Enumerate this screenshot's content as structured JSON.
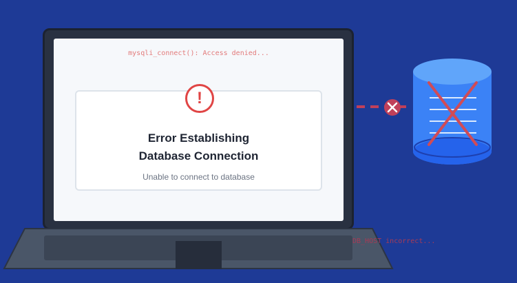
{
  "log": {
    "top": "mysqli_connect(): Access denied...",
    "bottom": "DB_HOST incorrect..."
  },
  "error": {
    "icon": "exclamation-circle-icon",
    "title_line1": "Error Establishing",
    "title_line2": "Database Connection",
    "subtitle": "Unable to connect to database"
  },
  "connection": {
    "status_icon": "x-circle-icon",
    "database_icon": "database-icon"
  },
  "colors": {
    "background": "#1e3a96",
    "error": "#e04545",
    "database": "#3b82f6",
    "broken_link": "#c0405a"
  }
}
